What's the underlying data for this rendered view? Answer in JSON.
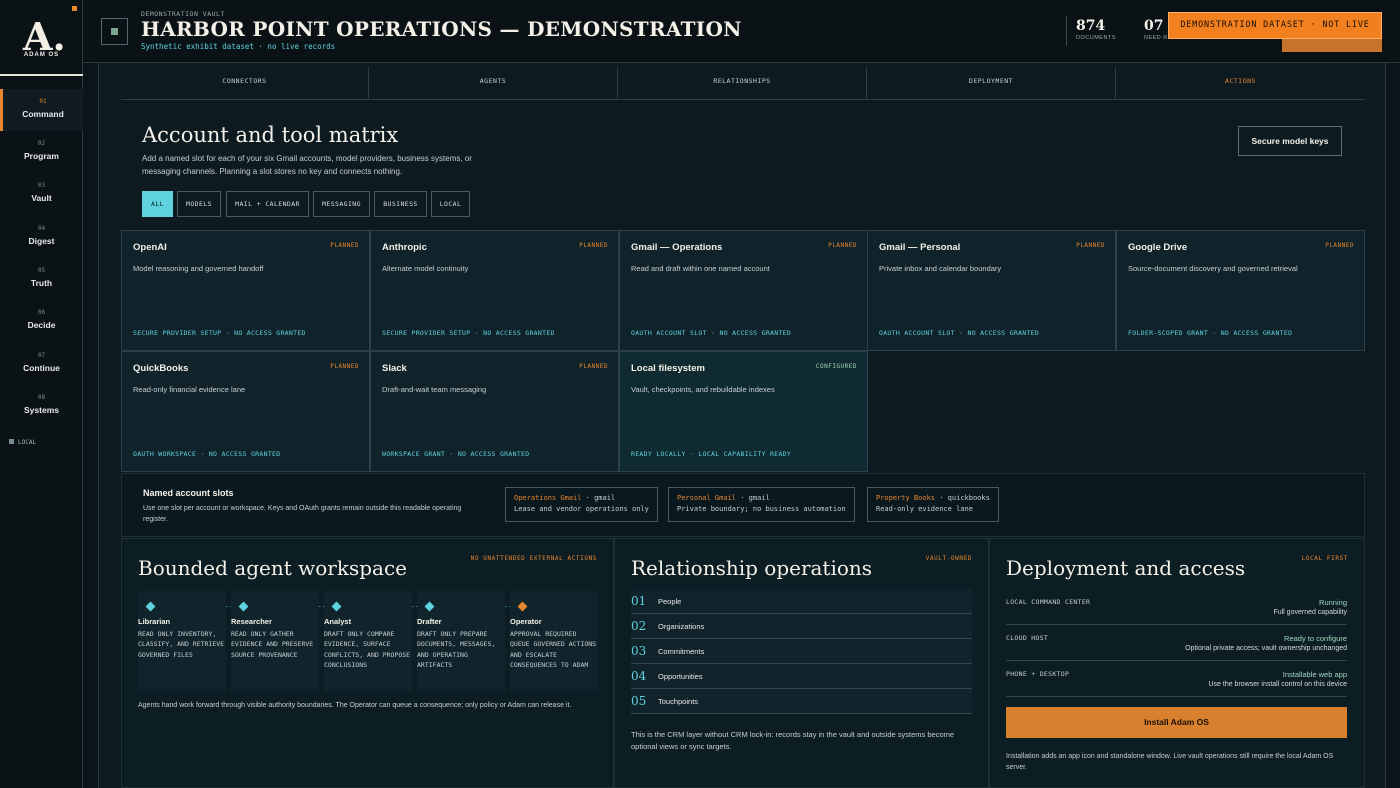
{
  "sidebar": {
    "logo_mark": "A.",
    "logo_text": "ADAM OS",
    "items": [
      {
        "num": "01",
        "label": "Command"
      },
      {
        "num": "02",
        "label": "Program"
      },
      {
        "num": "03",
        "label": "Vault"
      },
      {
        "num": "04",
        "label": "Digest"
      },
      {
        "num": "05",
        "label": "Truth"
      },
      {
        "num": "06",
        "label": "Decide"
      },
      {
        "num": "07",
        "label": "Continue"
      },
      {
        "num": "08",
        "label": "Systems"
      }
    ],
    "status": "LOCAL"
  },
  "header": {
    "eyebrow": "DEMONSTRATION VAULT",
    "title": "HARBOR POINT OPERATIONS — DEMONSTRATION",
    "subtitle": "Synthetic exhibit dataset · no live records",
    "stats": [
      {
        "value": "874",
        "label": "DOCUMENTS"
      },
      {
        "value": "07",
        "label": "NEED REVIEW"
      }
    ],
    "badge": "DEMONSTRATION DATASET · NOT LIVE"
  },
  "tabs": [
    "CONNECTORS",
    "AGENTS",
    "RELATIONSHIPS",
    "DEPLOYMENT",
    "ACTIONS"
  ],
  "matrix": {
    "title": "Account and tool matrix",
    "description": "Add a named slot for each of your six Gmail accounts, model providers, business systems, or messaging channels. Planning a slot stores no key and connects nothing.",
    "secure_button": "Secure model keys",
    "filters": [
      "ALL",
      "MODELS",
      "MAIL + CALENDAR",
      "MESSAGING",
      "BUSINESS",
      "LOCAL"
    ],
    "cards": [
      {
        "name": "OpenAI",
        "status": "PLANNED",
        "desc": "Model reasoning and governed handoff",
        "foot": "SECURE PROVIDER SETUP · NO ACCESS GRANTED"
      },
      {
        "name": "Anthropic",
        "status": "PLANNED",
        "desc": "Alternate model continuity",
        "foot": "SECURE PROVIDER SETUP · NO ACCESS GRANTED"
      },
      {
        "name": "Gmail — Operations",
        "status": "PLANNED",
        "desc": "Read and draft within one named account",
        "foot": "OAUTH ACCOUNT SLOT · NO ACCESS GRANTED"
      },
      {
        "name": "Gmail — Personal",
        "status": "PLANNED",
        "desc": "Private inbox and calendar boundary",
        "foot": "OAUTH ACCOUNT SLOT · NO ACCESS GRANTED"
      },
      {
        "name": "Google Drive",
        "status": "PLANNED",
        "desc": "Source-document discovery and governed retrieval",
        "foot": "FOLDER-SCOPED GRANT · NO ACCESS GRANTED"
      },
      {
        "name": "QuickBooks",
        "status": "PLANNED",
        "desc": "Read-only financial evidence lane",
        "foot": "OAUTH WORKSPACE · NO ACCESS GRANTED"
      },
      {
        "name": "Slack",
        "status": "PLANNED",
        "desc": "Draft-and-wait team messaging",
        "foot": "WORKSPACE GRANT · NO ACCESS GRANTED"
      },
      {
        "name": "Local filesystem",
        "status": "CONFIGURED",
        "desc": "Vault, checkpoints, and rebuildable indexes",
        "foot": "READY LOCALLY · LOCAL CAPABILITY READY"
      }
    ]
  },
  "slots": {
    "title": "Named account slots",
    "description": "Use one slot per account or workspace. Keys and OAuth grants remain outside this readable operating register.",
    "items": [
      {
        "name": "Operations Gmail",
        "kind": "gmail",
        "note": "Lease and vendor operations only"
      },
      {
        "name": "Personal Gmail",
        "kind": "gmail",
        "note": "Private boundary; no business automation"
      },
      {
        "name": "Property Books",
        "kind": "quickbooks",
        "note": "Read-only evidence lane"
      }
    ]
  },
  "agents": {
    "title": "Bounded agent workspace",
    "tag": "NO UNATTENDED EXTERNAL ACTIONS",
    "items": [
      {
        "name": "Librarian",
        "desc": "READ ONLY INVENTORY, CLASSIFY, AND RETRIEVE GOVERNED FILES"
      },
      {
        "name": "Researcher",
        "desc": "READ ONLY GATHER EVIDENCE AND PRESERVE SOURCE PROVENANCE"
      },
      {
        "name": "Analyst",
        "desc": "DRAFT ONLY COMPARE EVIDENCE, SURFACE CONFLICTS, AND PROPOSE CONCLUSIONS"
      },
      {
        "name": "Drafter",
        "desc": "DRAFT ONLY PREPARE DOCUMENTS, MESSAGES, AND OPERATING ARTIFACTS"
      },
      {
        "name": "Operator",
        "desc": "APPROVAL REQUIRED QUEUE GOVERNED ACTIONS AND ESCALATE CONSEQUENCES TO ADAM"
      }
    ],
    "footnote": "Agents hand work forward through visible authority boundaries. The Operator can queue a consequence; only policy or Adam can release it."
  },
  "relationships": {
    "title": "Relationship operations",
    "tag": "VAULT-OWNED",
    "items": [
      {
        "num": "01",
        "label": "People"
      },
      {
        "num": "02",
        "label": "Organizations"
      },
      {
        "num": "03",
        "label": "Commitments"
      },
      {
        "num": "04",
        "label": "Opportunities"
      },
      {
        "num": "05",
        "label": "Touchpoints"
      }
    ],
    "footnote": "This is the CRM layer without CRM lock-in: records stay in the vault and outside systems become optional views or sync targets."
  },
  "deployment": {
    "title": "Deployment and access",
    "tag": "LOCAL FIRST",
    "rows": [
      {
        "key": "LOCAL COMMAND CENTER",
        "state": "Running",
        "note": "Full governed capability"
      },
      {
        "key": "CLOUD HOST",
        "state": "Ready to configure",
        "note": "Optional private access; vault ownership unchanged"
      },
      {
        "key": "PHONE + DESKTOP",
        "state": "Installable web app",
        "note": "Use the browser install control on this device"
      }
    ],
    "install_button": "Install Adam OS",
    "footnote": "Installation adds an app icon and standalone window. Live vault operations still require the local Adam OS server."
  },
  "colors": {
    "accent": "#e8862f",
    "cyan": "#5fd2e0",
    "background": "#0b1419"
  }
}
